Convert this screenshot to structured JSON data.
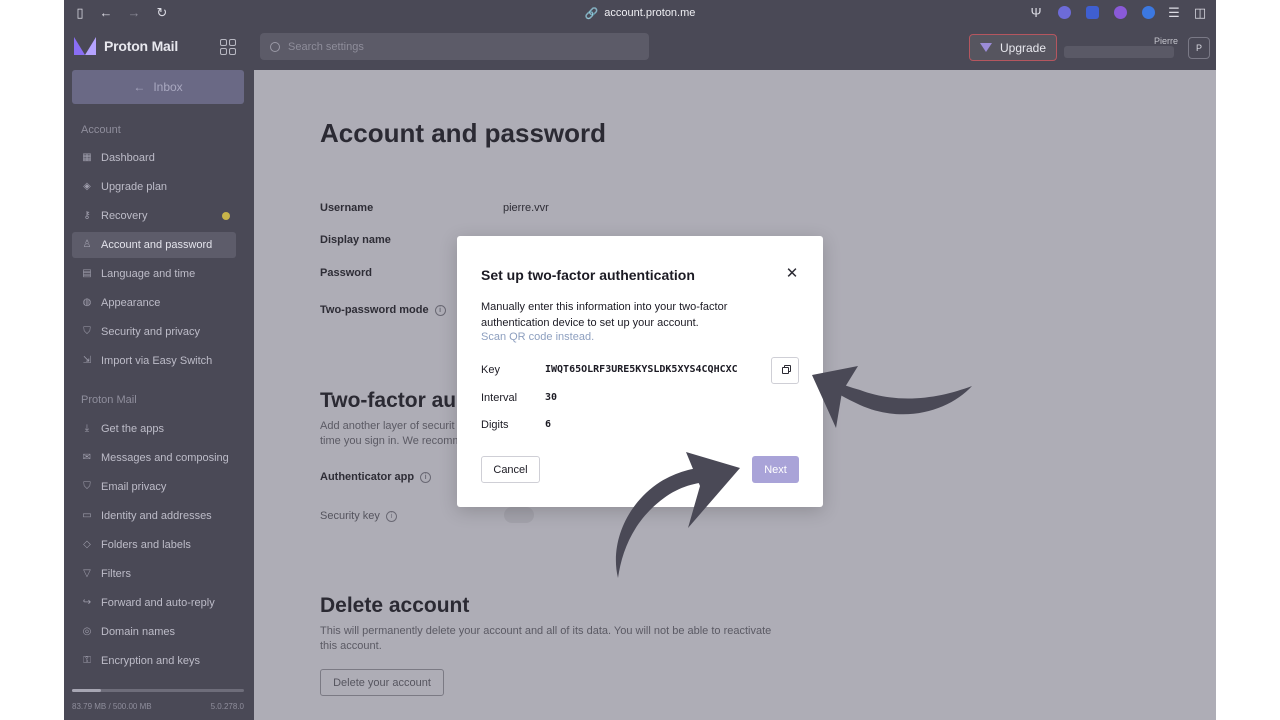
{
  "browser": {
    "url": "account.proton.me"
  },
  "header": {
    "brand": "Proton Mail",
    "search_placeholder": "Search settings",
    "upgrade_label": "Upgrade",
    "username": "Pierre",
    "avatar_initial": "P"
  },
  "sidebar": {
    "inbox_label": "Inbox",
    "sections": [
      {
        "label": "Account",
        "items": [
          {
            "label": "Dashboard",
            "icon": "dashboard-icon"
          },
          {
            "label": "Upgrade plan",
            "icon": "upgrade-icon"
          },
          {
            "label": "Recovery",
            "icon": "key-icon"
          },
          {
            "label": "Account and password",
            "icon": "user-icon"
          },
          {
            "label": "Language and time",
            "icon": "language-icon"
          },
          {
            "label": "Appearance",
            "icon": "palette-icon"
          },
          {
            "label": "Security and privacy",
            "icon": "shield-icon"
          },
          {
            "label": "Import via Easy Switch",
            "icon": "import-icon"
          }
        ]
      },
      {
        "label": "Proton Mail",
        "items": [
          {
            "label": "Get the apps",
            "icon": "download-icon"
          },
          {
            "label": "Messages and composing",
            "icon": "envelope-icon"
          },
          {
            "label": "Email privacy",
            "icon": "shield-icon"
          },
          {
            "label": "Identity and addresses",
            "icon": "card-icon"
          },
          {
            "label": "Folders and labels",
            "icon": "tag-icon"
          },
          {
            "label": "Filters",
            "icon": "filter-icon"
          },
          {
            "label": "Forward and auto-reply",
            "icon": "forward-icon"
          },
          {
            "label": "Domain names",
            "icon": "globe-icon"
          },
          {
            "label": "Encryption and keys",
            "icon": "lock-icon"
          }
        ]
      }
    ],
    "active_item": "Account and password",
    "storage_text": "83.79 MB / 500.00 MB",
    "storage_fraction": 0.17,
    "version": "5.0.278.0",
    "colors": {
      "recovery_dot": "#c7b44a"
    }
  },
  "main": {
    "title": "Account and password",
    "fields": {
      "username_label": "Username",
      "username_value": "pierre.vvr",
      "display_name_label": "Display name",
      "password_label": "Password",
      "two_password_label": "Two-password mode"
    },
    "twofa": {
      "title": "Two-factor au",
      "desc_line1": "Add another layer of securit",
      "desc_line2": "time you sign in. We recomm",
      "authenticator_label": "Authenticator app",
      "security_key_label": "Security key"
    },
    "delete": {
      "title": "Delete account",
      "desc_line1": "This will permanently delete your account and all of its data. You will not be able to reactivate",
      "desc_line2": "this account.",
      "button_label": "Delete your account"
    }
  },
  "modal": {
    "title": "Set up two-factor authentication",
    "desc_line1": "Manually enter this information into your two-factor",
    "desc_line2": "authentication device to set up your account.",
    "qr_link": "Scan QR code instead.",
    "key_label": "Key",
    "key_value": "IWQT65OLRF3URE5KYSLDK5XYS4CQHCXC",
    "interval_label": "Interval",
    "interval_value": "30",
    "digits_label": "Digits",
    "digits_value": "6",
    "cancel_label": "Cancel",
    "next_label": "Next",
    "colors": {
      "next_button": "#a9a3d8",
      "link": "#8d9fbf"
    }
  }
}
